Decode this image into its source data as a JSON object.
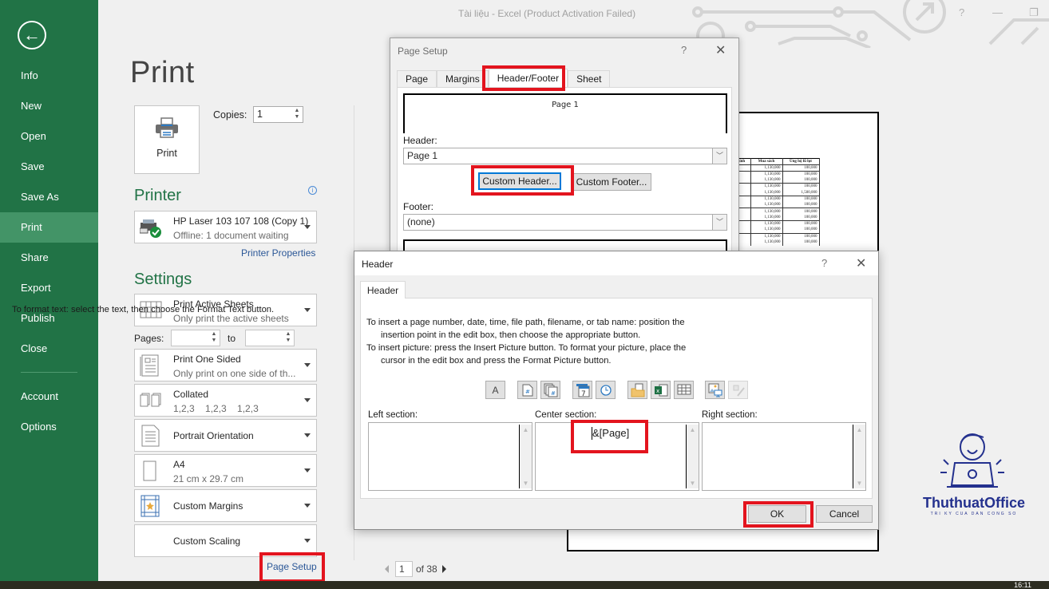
{
  "window": {
    "title": "Tài liệu - Excel (Product Activation Failed)",
    "help": "?",
    "minimize": "—",
    "restore": "❐"
  },
  "sidebar": {
    "back_icon": "←",
    "items": [
      {
        "label": "Info",
        "active": false
      },
      {
        "label": "New",
        "active": false
      },
      {
        "label": "Open",
        "active": false
      },
      {
        "label": "Save",
        "active": false
      },
      {
        "label": "Save As",
        "active": false
      },
      {
        "label": "Print",
        "active": true
      },
      {
        "label": "Share",
        "active": false
      },
      {
        "label": "Export",
        "active": false
      },
      {
        "label": "Publish",
        "active": false
      },
      {
        "label": "Close",
        "active": false
      },
      {
        "label": "Account",
        "active": false
      },
      {
        "label": "Options",
        "active": false
      }
    ]
  },
  "print": {
    "title": "Print",
    "print_button": "Print",
    "copies_label": "Copies:",
    "copies_value": "1",
    "printer_heading": "Printer",
    "printer": {
      "name": "HP Laser 103 107 108 (Copy 1)",
      "status": "Offline: 1 document waiting"
    },
    "printer_properties": "Printer Properties",
    "settings_heading": "Settings",
    "settings": [
      {
        "title": "Print Active Sheets",
        "subtitle": "Only print the active sheets"
      },
      {
        "title": "Print One Sided",
        "subtitle": "Only print on one side of th..."
      },
      {
        "title": "Collated",
        "subtitle": "1,2,3    1,2,3    1,2,3"
      },
      {
        "title": "Portrait Orientation",
        "subtitle": ""
      },
      {
        "title": "A4",
        "subtitle": "21 cm x 29.7 cm"
      },
      {
        "title": "Custom Margins",
        "subtitle": ""
      },
      {
        "title": "Custom Scaling",
        "subtitle": ""
      }
    ],
    "pages_label": "Pages:",
    "pages_to": "to",
    "pages_from_value": "",
    "pages_to_value": "",
    "page_setup_link": "Page Setup"
  },
  "preview": {
    "current_page": "1",
    "of_pages": "of 38",
    "table": {
      "headers": [
        "ính",
        "Mua sách",
        "Ủng hộ lũ lụt"
      ],
      "rows": [
        [
          "",
          "1,130,000",
          "100,000"
        ],
        [
          "",
          "1,130,000",
          "100,000"
        ],
        [
          "",
          "1,130,000",
          "100,000"
        ],
        [
          "",
          "1,130,000",
          "100,000"
        ],
        [
          "",
          "1,130,000",
          "1,500,000"
        ],
        [
          "",
          "1,130,000",
          "100,000"
        ],
        [
          "",
          "1,130,000",
          "100,000"
        ],
        [
          "",
          "1,130,000",
          "100,000"
        ],
        [
          "",
          "1,130,000",
          "100,000"
        ],
        [
          "",
          "1,130,000",
          "100,000"
        ],
        [
          "",
          "1,130,000",
          "100,000"
        ],
        [
          "",
          "1,130,000",
          "100,000"
        ],
        [
          "",
          "1,130,000",
          "100,000"
        ]
      ]
    }
  },
  "page_setup_dialog": {
    "title": "Page Setup",
    "help": "?",
    "close": "✕",
    "tabs": [
      {
        "label": "Page",
        "active": false
      },
      {
        "label": "Margins",
        "active": false
      },
      {
        "label": "Header/Footer",
        "active": true
      },
      {
        "label": "Sheet",
        "active": false
      }
    ],
    "header_preview": "Page 1",
    "header_label": "Header:",
    "header_value": "Page 1",
    "custom_header": "Custom Header...",
    "custom_footer": "Custom Footer...",
    "footer_label": "Footer:",
    "footer_value": "(none)"
  },
  "header_dialog": {
    "title": "Header",
    "help": "?",
    "close": "✕",
    "tab": "Header",
    "instructions": [
      "To format text:  select the text, then choose the Format Text button.",
      "To insert a page number, date, time, file path, filename, or tab name:  position the",
      "insertion point in the edit box, then choose the appropriate button.",
      "To insert picture: press the Insert Picture button.  To format your picture, place the",
      "cursor in the edit box and press the Format Picture button."
    ],
    "toolbar": [
      {
        "name": "format-text",
        "glyph": "A",
        "enabled": true
      },
      {
        "name": "insert-page-number",
        "glyph": "#",
        "enabled": true
      },
      {
        "name": "insert-number-of-pages",
        "glyph": "#",
        "enabled": true
      },
      {
        "name": "insert-date",
        "glyph": "7",
        "enabled": true
      },
      {
        "name": "insert-time",
        "glyph": "◷",
        "enabled": true
      },
      {
        "name": "insert-file-path",
        "glyph": "",
        "enabled": true
      },
      {
        "name": "insert-file-name",
        "glyph": "x",
        "enabled": true
      },
      {
        "name": "insert-sheet-name",
        "glyph": "",
        "enabled": true
      },
      {
        "name": "insert-picture",
        "glyph": "",
        "enabled": true
      },
      {
        "name": "format-picture",
        "glyph": "",
        "enabled": false
      }
    ],
    "left_label": "Left section:",
    "center_label": "Center section:",
    "right_label": "Right section:",
    "left_value": "",
    "center_value": "&[Page]",
    "right_value": "",
    "ok": "OK",
    "cancel": "Cancel"
  },
  "watermark": {
    "brand": "ThuthuatOffice",
    "tagline": "TRI KY CUA DAN CONG SO"
  },
  "taskbar": {
    "clock": "16:11"
  },
  "colors": {
    "excel_green": "#217346",
    "active_item": "#439467",
    "highlight_red": "#e3141e",
    "link_blue": "#2b5797",
    "focus_blue": "#0078d7"
  }
}
